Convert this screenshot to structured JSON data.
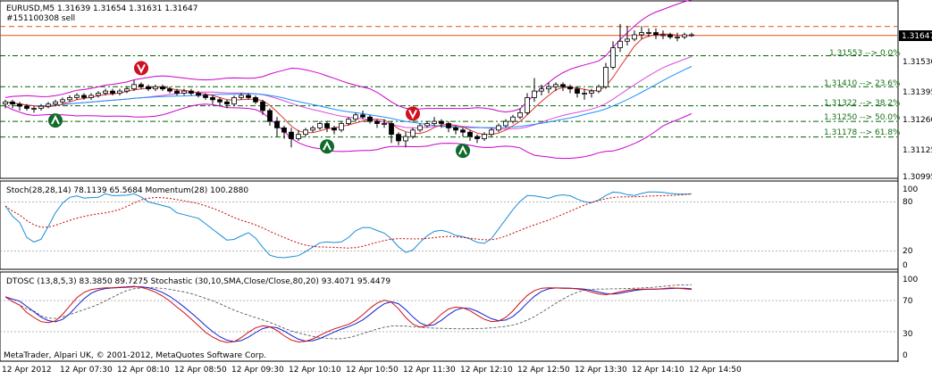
{
  "main": {
    "header": "EURUSD,M5  1.31639 1.31654 1.31631 1.31647",
    "order_label": "#151100308 sell",
    "price_ticks": [
      "1.31530",
      "1.31395",
      "1.31260",
      "1.31125",
      "1.30995"
    ],
    "current_price": "1.31647",
    "fib_labels": [
      "1.31553 --> 0.0%",
      "1.31410 --> 23.6%",
      "1.31322 --> 38.2%",
      "1.31250 --> 50.0%",
      "1.31178 --> 61.8%"
    ]
  },
  "stoch_panel": {
    "header": "Stoch(28,28,14) 78.1139 65.5684  Momentum(28) 100.2880",
    "ticks": [
      "100",
      "80",
      "20",
      "0"
    ]
  },
  "dtosc_panel": {
    "header": "DTOSC (13,8,5,3) 83.3850 89.7275  Stochastic (30,10,SMA,Close/Close,80,20) 93.4071 95.4479",
    "ticks": [
      "100",
      "70",
      "30",
      "0"
    ]
  },
  "copyright": "MetaTrader, Alpari UK, © 2001-2012, MetaQuotes Software Corp.",
  "time_labels": [
    "12 Apr 2012",
    "12 Apr 07:30",
    "12 Apr 08:10",
    "12 Apr 08:50",
    "12 Apr 09:30",
    "12 Apr 10:10",
    "12 Apr 10:50",
    "12 Apr 11:30",
    "12 Apr 12:10",
    "12 Apr 12:50",
    "12 Apr 13:30",
    "12 Apr 14:10",
    "12 Apr 14:50"
  ],
  "colors": {
    "bull": "#ffffff",
    "bear": "#000000",
    "bollinger": "#cc00cc",
    "sma_fast": "#e03030",
    "ma_slow": "#1e90ff",
    "order_line": "#e05010",
    "fib_line": "#006400",
    "stoch": "#1a8cd8",
    "signal": "#cc0000",
    "dtosc_slow": "#00dd00"
  },
  "chart_data": [
    {
      "type": "candlestick",
      "title": "EURUSD,M5",
      "x": [
        "07:00",
        "07:05",
        "07:10",
        "07:15",
        "07:20",
        "07:25",
        "07:30",
        "07:35",
        "07:40",
        "07:45",
        "07:50",
        "07:55",
        "08:00",
        "08:05",
        "08:10",
        "08:15",
        "08:20",
        "08:25",
        "08:30",
        "08:35",
        "08:40",
        "08:45",
        "08:50",
        "08:55",
        "09:00",
        "09:05",
        "09:10",
        "09:15",
        "09:20",
        "09:25",
        "09:30",
        "09:35",
        "09:40",
        "09:45",
        "09:50",
        "09:55",
        "10:00",
        "10:05",
        "10:10",
        "10:15",
        "10:20",
        "10:25",
        "10:30",
        "10:35",
        "10:40",
        "10:45",
        "10:50",
        "10:55",
        "11:00",
        "11:05",
        "11:10",
        "11:15",
        "11:20",
        "11:25",
        "11:30",
        "11:35",
        "11:40",
        "11:45",
        "11:50",
        "11:55",
        "12:00",
        "12:05",
        "12:10",
        "12:15",
        "12:20",
        "12:25",
        "12:30",
        "12:35",
        "12:40",
        "12:45",
        "12:50",
        "12:55",
        "13:00",
        "13:05",
        "13:10",
        "13:15",
        "13:20",
        "13:25",
        "13:30",
        "13:35",
        "13:40",
        "13:45",
        "13:50",
        "13:55",
        "14:00",
        "14:05",
        "14:10",
        "14:15",
        "14:20",
        "14:25",
        "14:30",
        "14:35",
        "14:40",
        "14:45",
        "14:50",
        "14:55",
        "15:00"
      ],
      "open": [
        1.3133,
        1.3134,
        1.3133,
        1.3132,
        1.3131,
        1.3131,
        1.3132,
        1.3133,
        1.3134,
        1.3135,
        1.3136,
        1.3137,
        1.3136,
        1.3137,
        1.3138,
        1.3139,
        1.3138,
        1.3139,
        1.314,
        1.3142,
        1.3141,
        1.314,
        1.3141,
        1.314,
        1.3139,
        1.3138,
        1.3139,
        1.3138,
        1.3137,
        1.3136,
        1.3135,
        1.3134,
        1.3133,
        1.3136,
        1.3137,
        1.3136,
        1.3134,
        1.313,
        1.3125,
        1.3122,
        1.312,
        1.3117,
        1.3119,
        1.3121,
        1.3122,
        1.3124,
        1.3122,
        1.3121,
        1.3124,
        1.3126,
        1.3128,
        1.3127,
        1.3125,
        1.3124,
        1.3124,
        1.3119,
        1.3116,
        1.3118,
        1.3121,
        1.3123,
        1.3124,
        1.3125,
        1.3124,
        1.3122,
        1.3121,
        1.312,
        1.3118,
        1.3117,
        1.3119,
        1.3121,
        1.3123,
        1.3125,
        1.3127,
        1.3129,
        1.3136,
        1.3139,
        1.314,
        1.3141,
        1.3142,
        1.3141,
        1.314,
        1.3138,
        1.3138,
        1.3139,
        1.3141,
        1.315,
        1.3159,
        1.3162,
        1.3163,
        1.3165,
        1.3166,
        1.3166,
        1.3165,
        1.3165,
        1.3164,
        1.3164,
        1.3165
      ],
      "close": [
        1.3134,
        1.3133,
        1.3132,
        1.3131,
        1.3131,
        1.3132,
        1.3133,
        1.3134,
        1.3135,
        1.3136,
        1.3137,
        1.3136,
        1.3137,
        1.3138,
        1.3139,
        1.3138,
        1.3139,
        1.314,
        1.3142,
        1.3141,
        1.314,
        1.3141,
        1.314,
        1.3139,
        1.3138,
        1.3139,
        1.3138,
        1.3137,
        1.3136,
        1.3135,
        1.3134,
        1.3133,
        1.3136,
        1.3137,
        1.3136,
        1.3134,
        1.313,
        1.3125,
        1.3122,
        1.312,
        1.3117,
        1.3119,
        1.3121,
        1.3122,
        1.3124,
        1.3122,
        1.3121,
        1.3124,
        1.3126,
        1.3128,
        1.3127,
        1.3125,
        1.3124,
        1.3124,
        1.3119,
        1.3116,
        1.3118,
        1.3121,
        1.3123,
        1.3124,
        1.3125,
        1.3124,
        1.3122,
        1.3121,
        1.312,
        1.3118,
        1.3117,
        1.3119,
        1.3121,
        1.3123,
        1.3125,
        1.3127,
        1.3129,
        1.3136,
        1.3139,
        1.314,
        1.3141,
        1.3142,
        1.3141,
        1.314,
        1.3138,
        1.3138,
        1.3139,
        1.3141,
        1.315,
        1.3159,
        1.3162,
        1.3163,
        1.3165,
        1.3166,
        1.3166,
        1.3165,
        1.3165,
        1.3164,
        1.3164,
        1.3165,
        1.3165
      ],
      "high": [
        1.3135,
        1.3135,
        1.3134,
        1.3133,
        1.3132,
        1.3133,
        1.3134,
        1.3135,
        1.3136,
        1.3137,
        1.3138,
        1.3138,
        1.3138,
        1.3139,
        1.314,
        1.314,
        1.314,
        1.3141,
        1.3144,
        1.3143,
        1.3142,
        1.3142,
        1.3142,
        1.3141,
        1.314,
        1.314,
        1.314,
        1.3139,
        1.3138,
        1.3137,
        1.3136,
        1.3135,
        1.3137,
        1.3138,
        1.3138,
        1.3137,
        1.3135,
        1.3131,
        1.3127,
        1.3123,
        1.3122,
        1.3121,
        1.3122,
        1.3123,
        1.3125,
        1.3125,
        1.3123,
        1.3125,
        1.3127,
        1.3129,
        1.313,
        1.3128,
        1.3126,
        1.3126,
        1.3125,
        1.312,
        1.312,
        1.3122,
        1.3124,
        1.3125,
        1.3127,
        1.3126,
        1.3125,
        1.3123,
        1.3122,
        1.3121,
        1.3119,
        1.312,
        1.3122,
        1.3124,
        1.3126,
        1.3128,
        1.3131,
        1.3138,
        1.3145,
        1.3142,
        1.3143,
        1.3143,
        1.3143,
        1.3142,
        1.3141,
        1.314,
        1.314,
        1.3142,
        1.3152,
        1.3162,
        1.317,
        1.3169,
        1.3167,
        1.3169,
        1.3168,
        1.3168,
        1.3167,
        1.3166,
        1.3166,
        1.3166,
        1.3166
      ],
      "low": [
        1.3131,
        1.3131,
        1.313,
        1.313,
        1.3129,
        1.313,
        1.3131,
        1.3132,
        1.3133,
        1.3134,
        1.3135,
        1.3135,
        1.3135,
        1.3136,
        1.3137,
        1.3137,
        1.3137,
        1.3138,
        1.3139,
        1.314,
        1.3139,
        1.3139,
        1.3139,
        1.3138,
        1.3137,
        1.3137,
        1.3137,
        1.3136,
        1.3135,
        1.3133,
        1.3132,
        1.3131,
        1.3132,
        1.3135,
        1.3135,
        1.3133,
        1.3128,
        1.3123,
        1.3118,
        1.3117,
        1.3113,
        1.3116,
        1.3118,
        1.312,
        1.3121,
        1.312,
        1.3119,
        1.312,
        1.3123,
        1.3125,
        1.3126,
        1.3124,
        1.3122,
        1.3122,
        1.3115,
        1.3114,
        1.3113,
        1.3117,
        1.312,
        1.3122,
        1.3123,
        1.3122,
        1.312,
        1.3119,
        1.3118,
        1.3116,
        1.3115,
        1.3116,
        1.3118,
        1.312,
        1.3122,
        1.3124,
        1.3126,
        1.3128,
        1.3134,
        1.3137,
        1.3138,
        1.3139,
        1.3139,
        1.3138,
        1.3136,
        1.3135,
        1.3136,
        1.3138,
        1.314,
        1.3149,
        1.3157,
        1.316,
        1.3162,
        1.3163,
        1.3164,
        1.3163,
        1.3163,
        1.3163,
        1.3162,
        1.3163,
        1.3164
      ],
      "overlays": [
        "Bollinger Bands",
        "Moving Average (fast)",
        "Moving Average (slow)",
        "Fibonacci retracement"
      ],
      "fib_levels": [
        {
          "price": 1.31553,
          "percent": "0.0%"
        },
        {
          "price": 1.3141,
          "percent": "23.6%"
        },
        {
          "price": 1.31322,
          "percent": "38.2%"
        },
        {
          "price": 1.3125,
          "percent": "50.0%"
        },
        {
          "price": 1.31178,
          "percent": "61.8%"
        }
      ],
      "order_line": 1.31647,
      "arrows": [
        {
          "type": "sell",
          "time": "08:35"
        },
        {
          "type": "buy",
          "time": "07:35"
        },
        {
          "type": "sell",
          "time": "11:45"
        },
        {
          "type": "buy",
          "time": "10:45"
        },
        {
          "type": "buy",
          "time": "12:20"
        }
      ],
      "ylim": [
        1.30995,
        1.3172
      ]
    },
    {
      "type": "line",
      "title": "Stoch(28,28,14)",
      "ylim": [
        0,
        100
      ],
      "series": [
        {
          "name": "Stoch",
          "last": 78.1139
        },
        {
          "name": "Signal",
          "last": 65.5684
        },
        {
          "name": "Momentum(28)",
          "last": 100.288
        }
      ]
    },
    {
      "type": "line",
      "title": "DTOSC (13,8,5,3)",
      "ylim": [
        0,
        100
      ],
      "series": [
        {
          "name": "DTOSC fast",
          "last": 83.385
        },
        {
          "name": "DTOSC slow",
          "last": 89.7275
        },
        {
          "name": "Stochastic main",
          "last": 93.4071
        },
        {
          "name": "Stochastic signal",
          "last": 95.4479
        }
      ]
    }
  ]
}
